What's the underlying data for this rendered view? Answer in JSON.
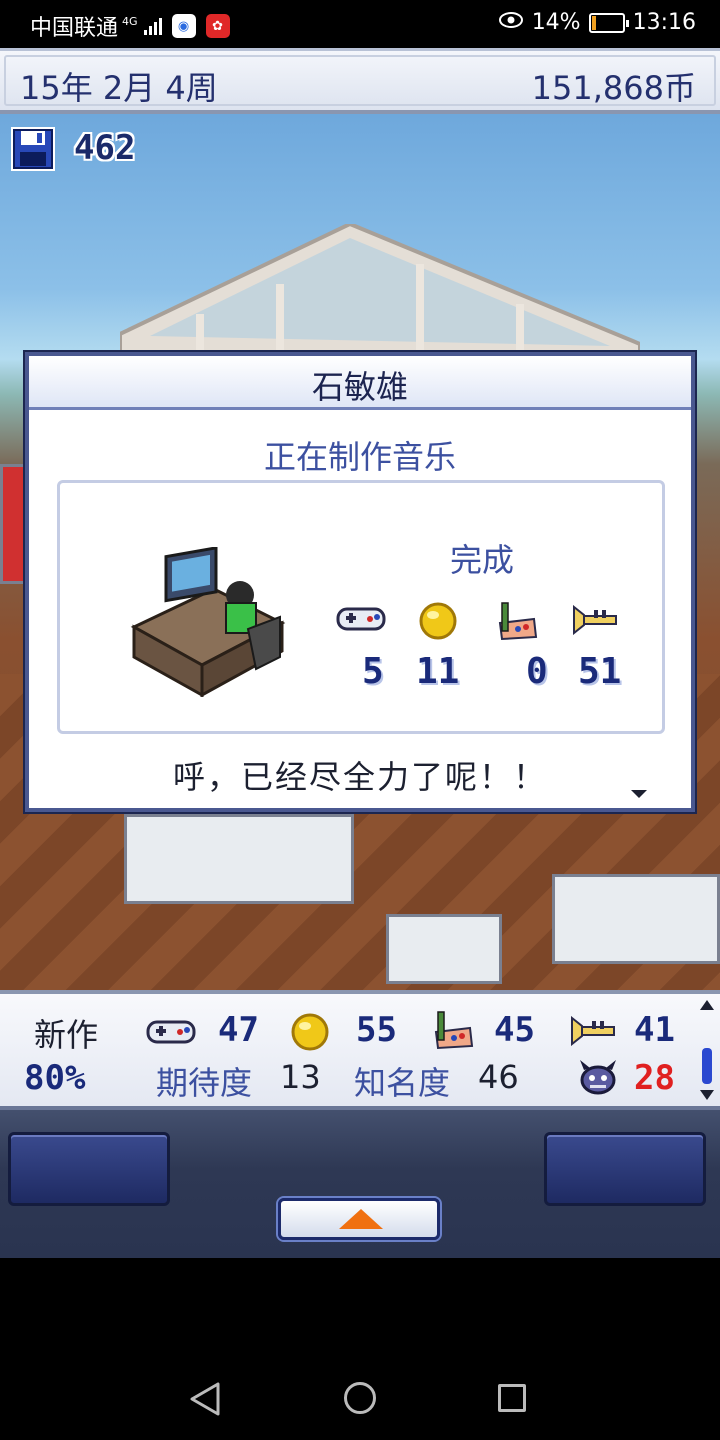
{
  "status_bar": {
    "carrier": "中国联通",
    "network": "4G",
    "battery_percent": "14%",
    "battery_level": 0.14,
    "time": "13:16"
  },
  "top_bar": {
    "date": "15年 2月 4周",
    "money": "151,868币"
  },
  "save": {
    "count": "462"
  },
  "dialog": {
    "name": "石敏雄",
    "status": "正在制作音乐",
    "done_label": "完成",
    "stats": [
      {
        "icon": "gamepad-icon",
        "value": "5"
      },
      {
        "icon": "gold-orb-icon",
        "value": "11"
      },
      {
        "icon": "paintbrush-icon",
        "value": "0"
      },
      {
        "icon": "trumpet-icon",
        "value": "51"
      }
    ],
    "message": "呼，已经尽全力了呢！！"
  },
  "info_panel": {
    "new_label": "新作",
    "progress": "80%",
    "stats": [
      {
        "icon": "gamepad-icon",
        "value": "47"
      },
      {
        "icon": "gold-orb-icon",
        "value": "55"
      },
      {
        "icon": "paintbrush-icon",
        "value": "45"
      },
      {
        "icon": "trumpet-icon",
        "value": "41"
      }
    ],
    "expectation_label": "期待度",
    "expectation_value": "13",
    "fame_label": "知名度",
    "fame_value": "46",
    "bugs_value": "28"
  },
  "colors": {
    "accent_blue": "#3c50a0",
    "dark_navy": "#1a2a7a",
    "bug_red": "#e02020",
    "arrow_orange": "#f07010"
  }
}
